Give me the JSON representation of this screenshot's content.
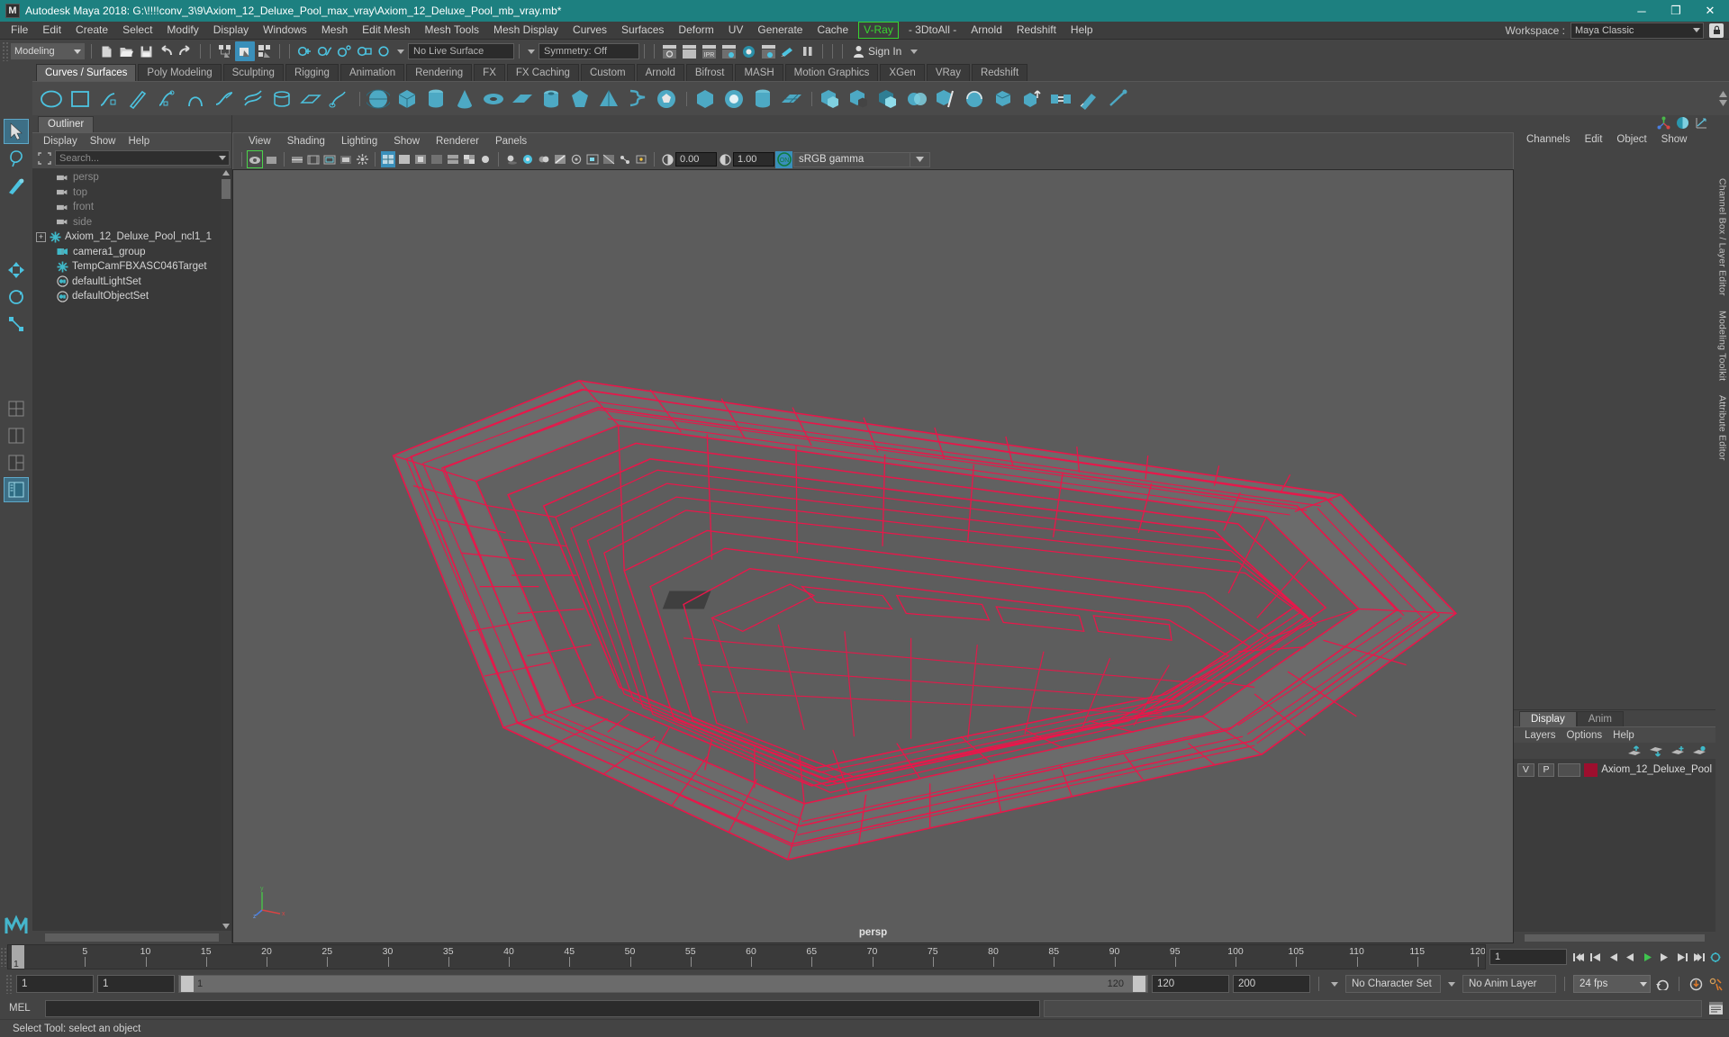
{
  "titlebar": {
    "app_title": "Autodesk Maya 2018: G:\\!!!!conv_3\\9\\Axiom_12_Deluxe_Pool_max_vray\\Axiom_12_Deluxe_Pool_mb_vray.mb*",
    "logo": "M",
    "minimize": "─",
    "maximize": "❐",
    "close": "✕"
  },
  "menubar": {
    "items": [
      "File",
      "Edit",
      "Create",
      "Select",
      "Modify",
      "Display",
      "Windows",
      "Mesh",
      "Edit Mesh",
      "Mesh Tools",
      "Mesh Display",
      "Curves",
      "Surfaces",
      "Deform",
      "UV",
      "Generate",
      "Cache",
      "V-Ray",
      "- 3DtoAll -",
      "Arnold",
      "Redshift",
      "Help"
    ],
    "highlighted": "V-Ray",
    "highlight_color": "#38d430",
    "workspace_label": "Workspace :",
    "workspace_value": "Maya Classic"
  },
  "statusbar": {
    "mode": "Modeling",
    "live_surface": "No Live Surface",
    "symmetry": "Symmetry: Off",
    "signin": "Sign In"
  },
  "shelf": {
    "tabs": [
      "Curves / Surfaces",
      "Poly Modeling",
      "Sculpting",
      "Rigging",
      "Animation",
      "Rendering",
      "FX",
      "FX Caching",
      "Custom",
      "Arnold",
      "Bifrost",
      "MASH",
      "Motion Graphics",
      "XGen",
      "VRay",
      "Redshift"
    ],
    "active_tab": "Curves / Surfaces"
  },
  "outliner": {
    "tab": "Outliner",
    "menus": [
      "Display",
      "Show",
      "Help"
    ],
    "search_placeholder": "Search...",
    "items": [
      {
        "label": "persp",
        "icon": "camera-icon",
        "dim": true,
        "indent": 1,
        "expand": false
      },
      {
        "label": "top",
        "icon": "camera-icon",
        "dim": true,
        "indent": 1,
        "expand": false
      },
      {
        "label": "front",
        "icon": "camera-icon",
        "dim": true,
        "indent": 1,
        "expand": false
      },
      {
        "label": "side",
        "icon": "camera-icon",
        "dim": true,
        "indent": 1,
        "expand": false
      },
      {
        "label": "Axiom_12_Deluxe_Pool_ncl1_1",
        "icon": "transform-icon",
        "dim": false,
        "indent": 0,
        "expand": true
      },
      {
        "label": "camera1_group",
        "icon": "group-icon",
        "dim": false,
        "indent": 1,
        "expand": false
      },
      {
        "label": "TempCamFBXASC046Target",
        "icon": "transform-icon",
        "dim": false,
        "indent": 1,
        "expand": false
      },
      {
        "label": "defaultLightSet",
        "icon": "set-icon",
        "dim": false,
        "indent": 1,
        "expand": false
      },
      {
        "label": "defaultObjectSet",
        "icon": "set-icon",
        "dim": false,
        "indent": 1,
        "expand": false
      }
    ]
  },
  "viewport": {
    "menus": [
      "View",
      "Shading",
      "Lighting",
      "Show",
      "Renderer",
      "Panels"
    ],
    "exposure_value": "0.00",
    "gamma_value": "1.00",
    "color_management": "sRGB gamma",
    "camera_label": "persp",
    "background_color": "#5c5c5c",
    "wireframe_color": "#e8174a",
    "axis_labels": [
      "y",
      "x",
      "z"
    ]
  },
  "right_panel": {
    "menus": [
      "Channels",
      "Edit",
      "Object",
      "Show"
    ],
    "vertical_tabs": [
      "Channel Box / Layer Editor",
      "Modeling Toolkit",
      "Attribute Editor"
    ]
  },
  "layer_editor": {
    "tabs": [
      "Display",
      "Anim"
    ],
    "active_tab": "Display",
    "menus": [
      "Layers",
      "Options",
      "Help"
    ],
    "layers": [
      {
        "visible": "V",
        "playback": "P",
        "color": "#9d0f2e",
        "name": "Axiom_12_Deluxe_Pool"
      }
    ]
  },
  "timeline": {
    "ticks": [
      5,
      10,
      15,
      20,
      25,
      30,
      35,
      40,
      45,
      50,
      55,
      60,
      65,
      70,
      75,
      80,
      85,
      90,
      95,
      100,
      105,
      110,
      115,
      120
    ],
    "current_frame": "1",
    "frame_field": "1",
    "range_start_field": "1",
    "range_start_inner": "1",
    "range_end_inner": "120",
    "range_end_field": "120",
    "playback_end_field": "200",
    "character_set": "No Character Set",
    "anim_layer": "No Anim Layer",
    "fps": "24 fps"
  },
  "command_line": {
    "label": "MEL",
    "input_value": "",
    "output_value": ""
  },
  "status_line": {
    "message": "Select Tool: select an object"
  }
}
